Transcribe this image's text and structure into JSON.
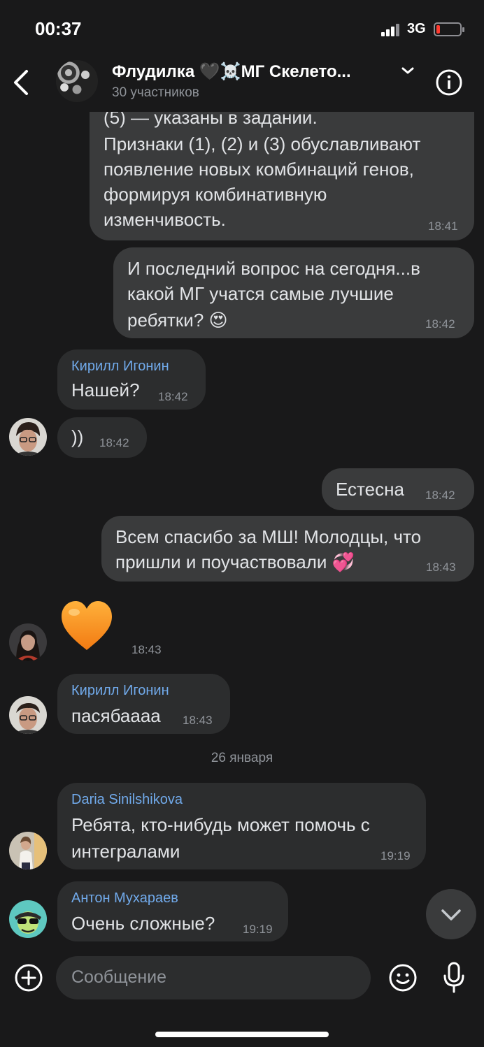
{
  "status": {
    "time": "00:37",
    "network": "3G"
  },
  "header": {
    "title": "Флудилка 🖤☠️МГ Скелето...",
    "subtitle": "30 участников"
  },
  "messages": [
    {
      "lines": [
        "(5) — указаны в задании.",
        "Признаки (1), (2) и (3) обуславливают",
        "появление новых комбинаций генов,",
        "формируя комбинативную",
        "изменчивость."
      ],
      "time": "18:41"
    },
    {
      "lines": [
        "И последний вопрос на сегодня...в",
        "какой МГ учатся самые лучшие",
        "ребятки? 😍"
      ],
      "time": "18:42"
    },
    {
      "author": "Кирилл Игонин",
      "text": "Нашей?",
      "time": "18:42"
    },
    {
      "text": "))",
      "time": "18:42"
    },
    {
      "text": "Естесна",
      "time": "18:42"
    },
    {
      "lines": [
        "Всем спасибо за МШ! Молодцы, что",
        "пришли и поучаствовали 💞"
      ],
      "time": "18:43"
    },
    {
      "sticker": "orange-heart",
      "time": "18:43"
    },
    {
      "author": "Кирилл Игонин",
      "text": "пасябаааа",
      "time": "18:43"
    },
    {
      "author": "Daria Sinilshikova",
      "lines": [
        "Ребята, кто-нибудь может помочь с",
        "интегралами"
      ],
      "time": "19:19"
    },
    {
      "author": "Антон Мухараев",
      "text": "Очень сложные?",
      "time": "19:19"
    }
  ],
  "date_separator": "26 января",
  "composer": {
    "placeholder": "Сообщение"
  },
  "colors": {
    "background": "#19191a",
    "bubble_in": "#2c2d2e",
    "bubble_out": "#3a3b3c",
    "author_name": "#71aaeb",
    "battery_low": "#ff3b30"
  }
}
